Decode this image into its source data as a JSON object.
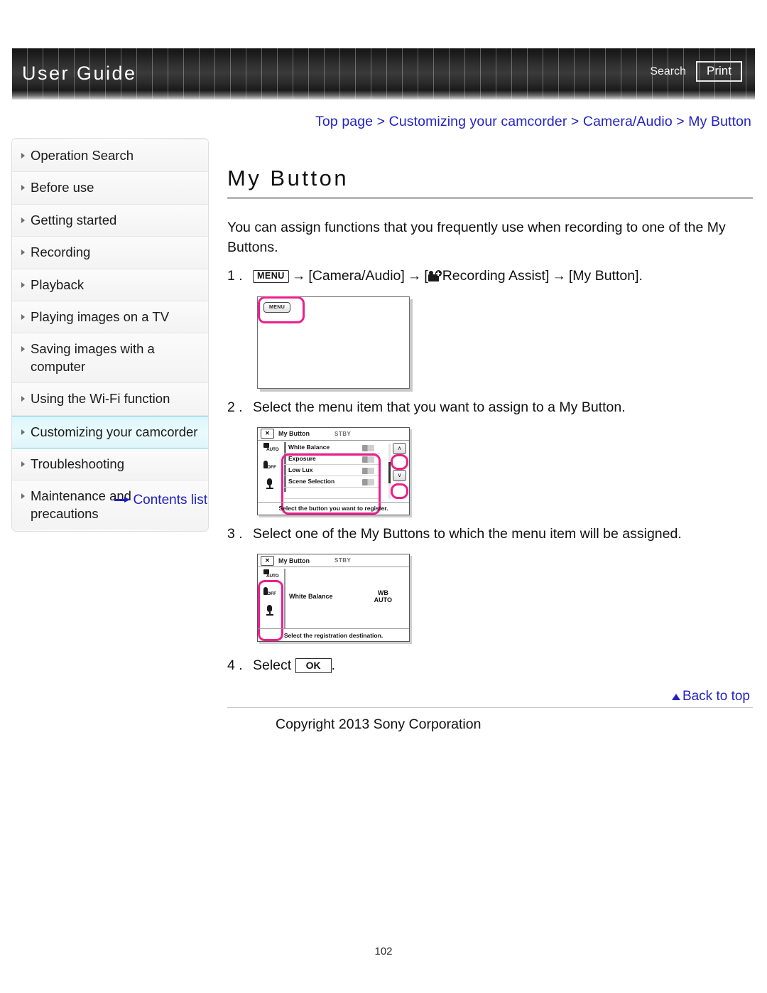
{
  "header": {
    "title": "User Guide",
    "search_label": "Search",
    "print_label": "Print"
  },
  "sidebar": {
    "items": [
      {
        "label": "Operation Search",
        "active": false
      },
      {
        "label": "Before use",
        "active": false
      },
      {
        "label": "Getting started",
        "active": false
      },
      {
        "label": "Recording",
        "active": false
      },
      {
        "label": "Playback",
        "active": false
      },
      {
        "label": "Playing images on a TV",
        "active": false
      },
      {
        "label": "Saving images with a computer",
        "active": false
      },
      {
        "label": "Using the Wi-Fi function",
        "active": false
      },
      {
        "label": "Customizing your camcorder",
        "active": true
      },
      {
        "label": "Troubleshooting",
        "active": false
      },
      {
        "label": "Maintenance and precautions",
        "active": false
      }
    ],
    "contents_link": "Contents list",
    "highlight_color": "#e4f8fc",
    "link_color": "#2020c0"
  },
  "main": {
    "breadcrumb": "Top page > Customizing your camcorder > Camera/Audio > My Button",
    "title": "My Button",
    "intro": "You can assign functions that you frequently use when recording to one of the My Buttons.",
    "steps": [
      {
        "num": "1 .",
        "menu_key": "MENU",
        "arrow": "→",
        "part1": "[Camera/Audio]",
        "icon": "recording-assist-icon",
        "part2": "Recording Assist]",
        "open_bracket": "[",
        "part3": "[My Button]."
      },
      {
        "num": "2 .",
        "text": "Select the menu item that you want to assign to a My Button."
      },
      {
        "num": "3 .",
        "text": "Select one of the My Buttons to which the menu item will be assigned."
      },
      {
        "num": "4 .",
        "select_label": "Select",
        "ok_key": "OK",
        "period": "."
      }
    ],
    "back_to_top": "Back to top",
    "copyright": "Copyright 2013 Sony Corporation"
  },
  "figures": {
    "fig1": {
      "menu_button_label": "MENU",
      "highlight_color": "#ec1f8d"
    },
    "fig2": {
      "close_label": "✕",
      "title": "My Button",
      "status": "STBY",
      "rows": [
        {
          "name": "White Balance"
        },
        {
          "name": "Exposure"
        },
        {
          "name": "Low Lux"
        },
        {
          "name": "Scene Selection"
        }
      ],
      "up_arrow": "∧",
      "down_arrow": "∨",
      "hint": "Select the button you want to register.",
      "left_icons": [
        "auto-icon",
        "flash-off-icon",
        "mic-icon"
      ],
      "auto_label": "AUTO",
      "off_label": "OFF"
    },
    "fig3": {
      "close_label": "✕",
      "title": "My Button",
      "status": "STBY",
      "assigned_item": "White Balance",
      "assigned_value_line1": "WB",
      "assigned_value_line2": "AUTO",
      "hint": "Select the registration destination.",
      "auto_label": "AUTO",
      "off_label": "OFF"
    }
  },
  "page_number": "102"
}
